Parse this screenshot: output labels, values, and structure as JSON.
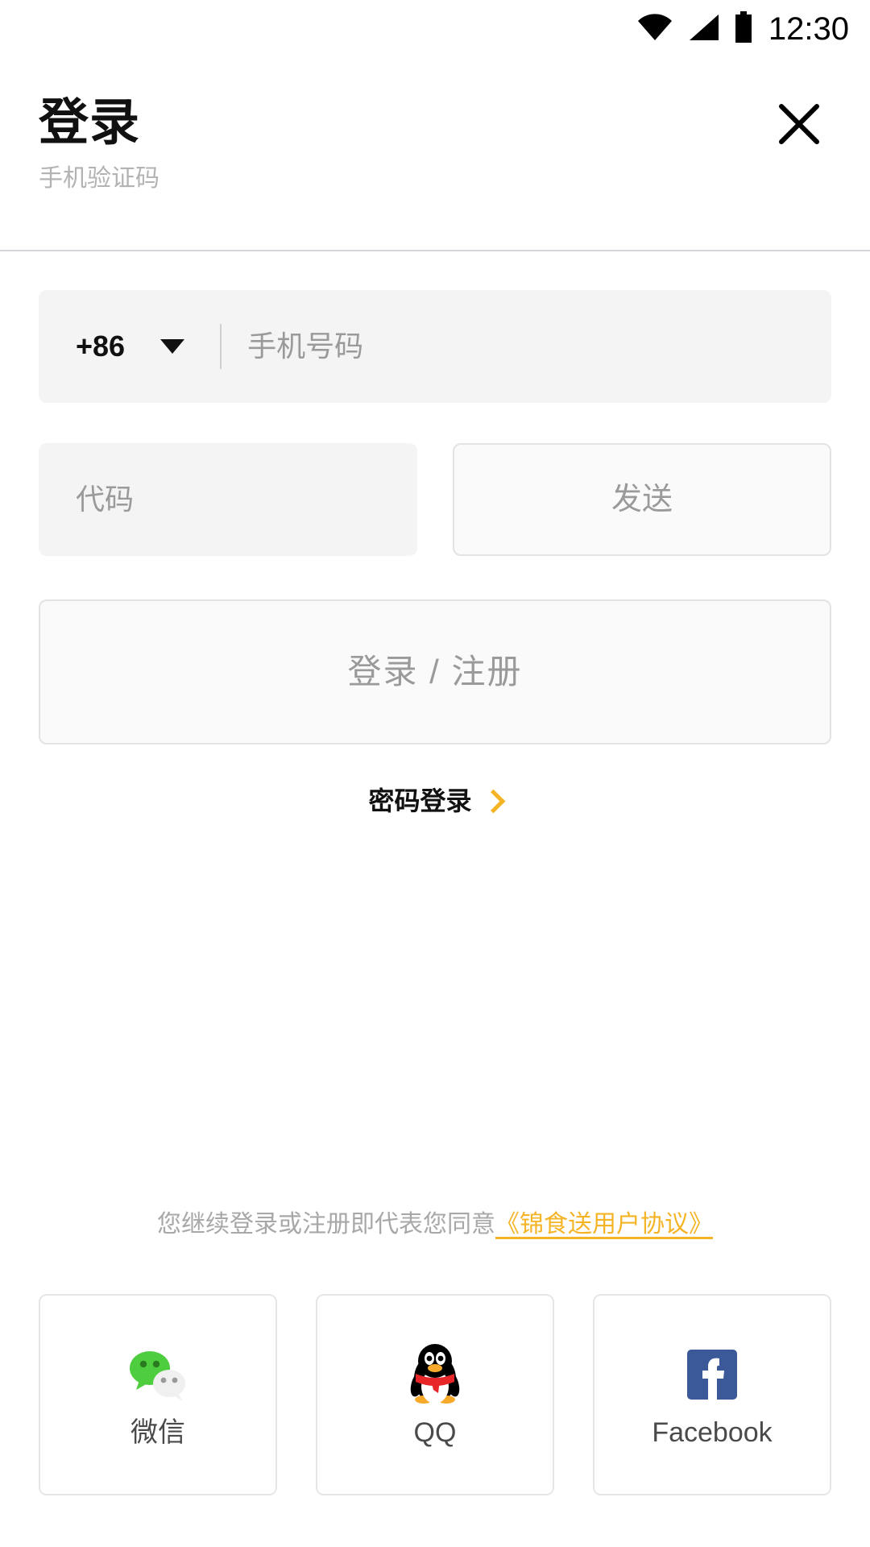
{
  "status_bar": {
    "time": "12:30",
    "icons": [
      "wifi-icon",
      "signal-icon",
      "battery-icon"
    ]
  },
  "header": {
    "title": "登录",
    "subtitle": "手机验证码",
    "close_icon": "close-icon"
  },
  "form": {
    "country_code": "+86",
    "country_dropdown_icon": "chevron-down-icon",
    "phone_placeholder": "手机号码",
    "phone_value": "",
    "code_placeholder": "代码",
    "code_value": "",
    "send_label": "发送",
    "submit_label": "登录 / 注册",
    "password_login_label": "密码登录",
    "password_login_chevron": "chevron-right-icon"
  },
  "agreement": {
    "text": "您继续登录或注册即代表您同意",
    "link": "《锦食送用户协议》"
  },
  "social": {
    "items": [
      {
        "label": "微信",
        "icon": "wechat-icon"
      },
      {
        "label": "QQ",
        "icon": "qq-icon"
      },
      {
        "label": "Facebook",
        "icon": "facebook-icon"
      }
    ]
  },
  "colors": {
    "accent": "#f5b426",
    "field_bg": "#f4f4f4",
    "border": "#e3e3e3",
    "muted_text": "#9a9a9a",
    "wechat_green": "#4ecd3f",
    "qq_red": "#e8262a",
    "qq_orange": "#f7a92b",
    "facebook_blue": "#3b5998"
  }
}
